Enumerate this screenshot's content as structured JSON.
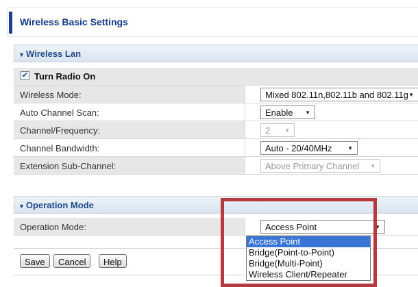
{
  "page": {
    "title": "Wireless Basic Settings"
  },
  "wireless_lan": {
    "header": "Wireless Lan",
    "turn_radio_on": {
      "label": "Turn Radio On",
      "checked": true
    },
    "rows": {
      "mode": {
        "label": "Wireless Mode:",
        "value": "Mixed 802.11n,802.11b and 802.11g"
      },
      "channel_scan": {
        "label": "Auto Channel Scan:",
        "value": "Enable"
      },
      "channel_freq": {
        "label": "Channel/Frequency:",
        "value": "2"
      },
      "bandwidth": {
        "label": "Channel Bandwidth:",
        "value": "Auto - 20/40MHz"
      },
      "ext_channel": {
        "label": "Extension Sub-Channel:",
        "value": "Above Primary Channel"
      }
    }
  },
  "operation_mode": {
    "header": "Operation Mode",
    "label": "Operation Mode:",
    "value": "Access Point",
    "options": [
      "Access Point",
      "Bridge(Point-to-Point)",
      "Bridge(Multi-Point)",
      "Wireless Client/Repeater"
    ]
  },
  "buttons": {
    "save": "Save",
    "cancel": "Cancel",
    "help": "Help"
  },
  "colors": {
    "accent": "#1f3b9a",
    "section_text": "#1e4a8c",
    "highlight": "#b5393f",
    "selected_option": "#3875d7"
  },
  "icons": {
    "collapse": "triangle-down-icon",
    "dropdown": "chevron-down-icon",
    "checkbox": "checkmark-icon"
  }
}
